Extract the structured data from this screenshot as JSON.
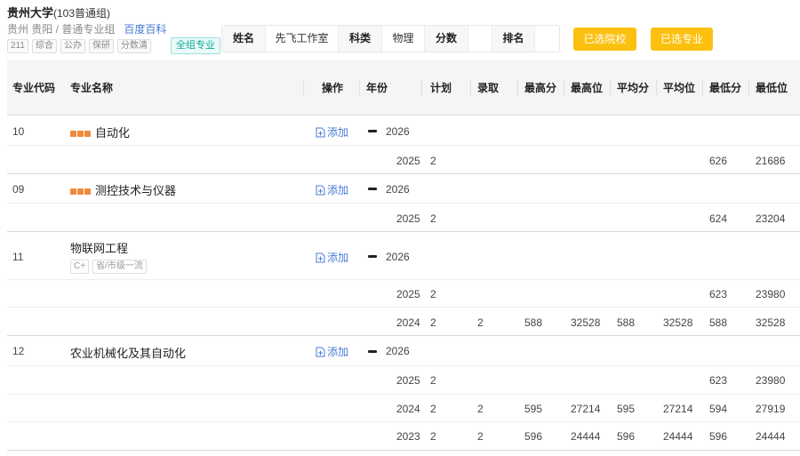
{
  "school": {
    "name": "贵州大学",
    "group": "(103普通组)",
    "location": "贵州 贵阳 / 普通专业组",
    "baike_link": "百度百科",
    "tags": [
      "211",
      "综合",
      "公办",
      "保研",
      "分数清"
    ],
    "all_major_label": "全组专业"
  },
  "student": {
    "name_label": "姓名",
    "name_value": "先飞工作室",
    "subject_label": "科类",
    "subject_value": "物理",
    "score_label": "分数",
    "score_value": "",
    "rank_label": "排名",
    "rank_value": ""
  },
  "buttons": {
    "selected_school": "已选院校",
    "selected_major": "已选专业"
  },
  "table": {
    "headers": {
      "code": "专业代码",
      "name": "专业名称",
      "op": "操作",
      "year": "年份",
      "plan": "计划",
      "admit": "录取",
      "max_score": "最高分",
      "max_rank": "最高位",
      "avg_score": "平均分",
      "avg_rank": "平均位",
      "min_score": "最低分",
      "min_rank": "最低位"
    },
    "add_label": "添加",
    "majors": [
      {
        "code": "10",
        "name": "自动化",
        "current_year": "2026",
        "history": [
          {
            "year": "2025",
            "plan": "2",
            "admit": "",
            "max_score": "",
            "max_rank": "",
            "avg_score": "",
            "avg_rank": "",
            "min_score": "626",
            "min_rank": "21686"
          }
        ]
      },
      {
        "code": "09",
        "name": "测控技术与仪器",
        "current_year": "2026",
        "history": [
          {
            "year": "2025",
            "plan": "2",
            "admit": "",
            "max_score": "",
            "max_rank": "",
            "avg_score": "",
            "avg_rank": "",
            "min_score": "624",
            "min_rank": "23204"
          }
        ]
      },
      {
        "code": "11",
        "name": "物联网工程",
        "current_year": "2026",
        "sub_tags": [
          "C+",
          "省/市级一流"
        ],
        "history": [
          {
            "year": "2025",
            "plan": "2",
            "admit": "",
            "max_score": "",
            "max_rank": "",
            "avg_score": "",
            "avg_rank": "",
            "min_score": "623",
            "min_rank": "23980"
          },
          {
            "year": "2024",
            "plan": "2",
            "admit": "2",
            "max_score": "588",
            "max_rank": "32528",
            "avg_score": "588",
            "avg_rank": "32528",
            "min_score": "588",
            "min_rank": "32528"
          }
        ]
      },
      {
        "code": "12",
        "name": "农业机械化及其自动化",
        "current_year": "2026",
        "history": [
          {
            "year": "2025",
            "plan": "2",
            "admit": "",
            "max_score": "",
            "max_rank": "",
            "avg_score": "",
            "avg_rank": "",
            "min_score": "623",
            "min_rank": "23980"
          },
          {
            "year": "2024",
            "plan": "2",
            "admit": "2",
            "max_score": "595",
            "max_rank": "27214",
            "avg_score": "595",
            "avg_rank": "27214",
            "min_score": "594",
            "min_rank": "27919"
          },
          {
            "year": "2023",
            "plan": "2",
            "admit": "2",
            "max_score": "596",
            "max_rank": "24444",
            "avg_score": "596",
            "avg_rank": "24444",
            "min_score": "596",
            "min_rank": "24444"
          }
        ]
      }
    ]
  }
}
